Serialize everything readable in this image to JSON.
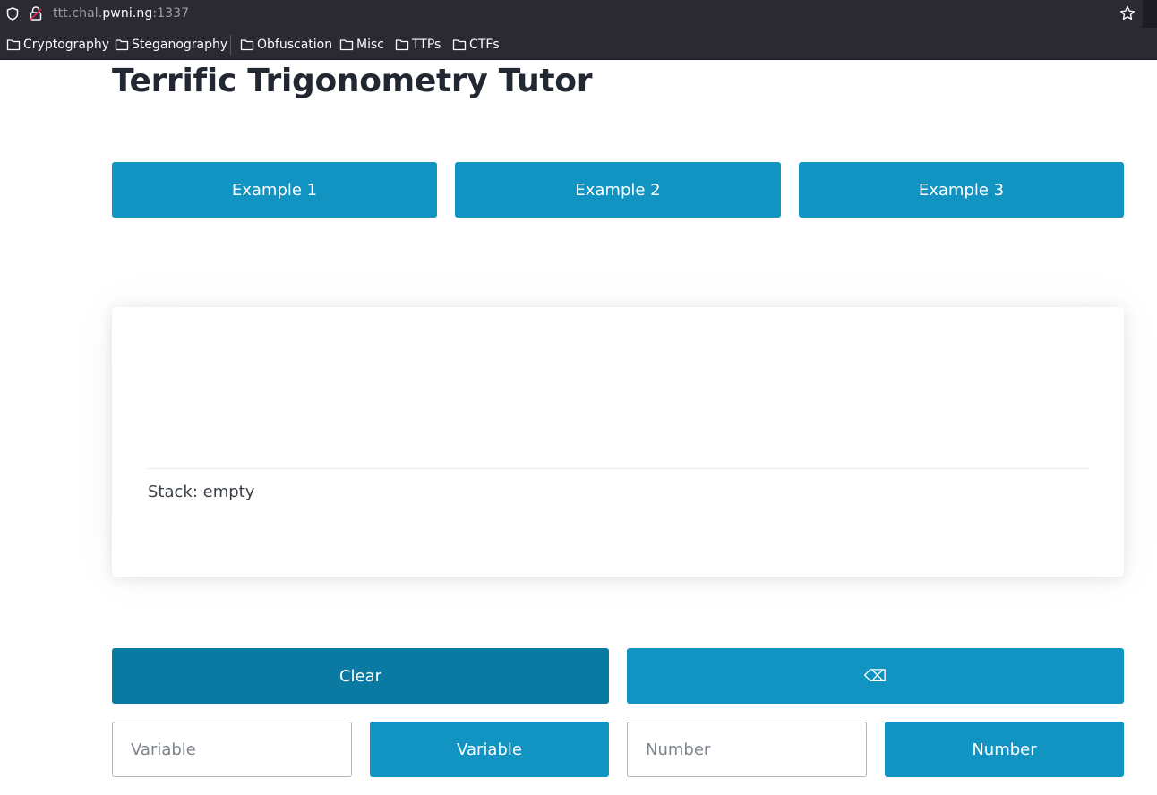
{
  "browser": {
    "url_prefix": "ttt.chal.",
    "url_domain": "pwni.ng",
    "url_port": ":1337",
    "bookmarks": [
      "Cryptography",
      "Steganography",
      "Obfuscation",
      "Misc",
      "TTPs",
      "CTFs"
    ]
  },
  "page": {
    "title": "Terrific Trigonometry Tutor"
  },
  "examples": {
    "example1": "Example 1",
    "example2": "Example 2",
    "example3": "Example 3"
  },
  "display": {
    "stack_text": "Stack: empty"
  },
  "controls": {
    "clear": "Clear",
    "backspace": "⌫",
    "variable_placeholder": "Variable",
    "variable_button": "Variable",
    "number_placeholder": "Number",
    "number_button": "Number"
  },
  "colors": {
    "primary": "#1194c2",
    "primary_dark": "#0b7aa3",
    "title": "#222831"
  },
  "icons": [
    "shield-icon",
    "lock-icon",
    "star-icon",
    "folder-icon"
  ]
}
